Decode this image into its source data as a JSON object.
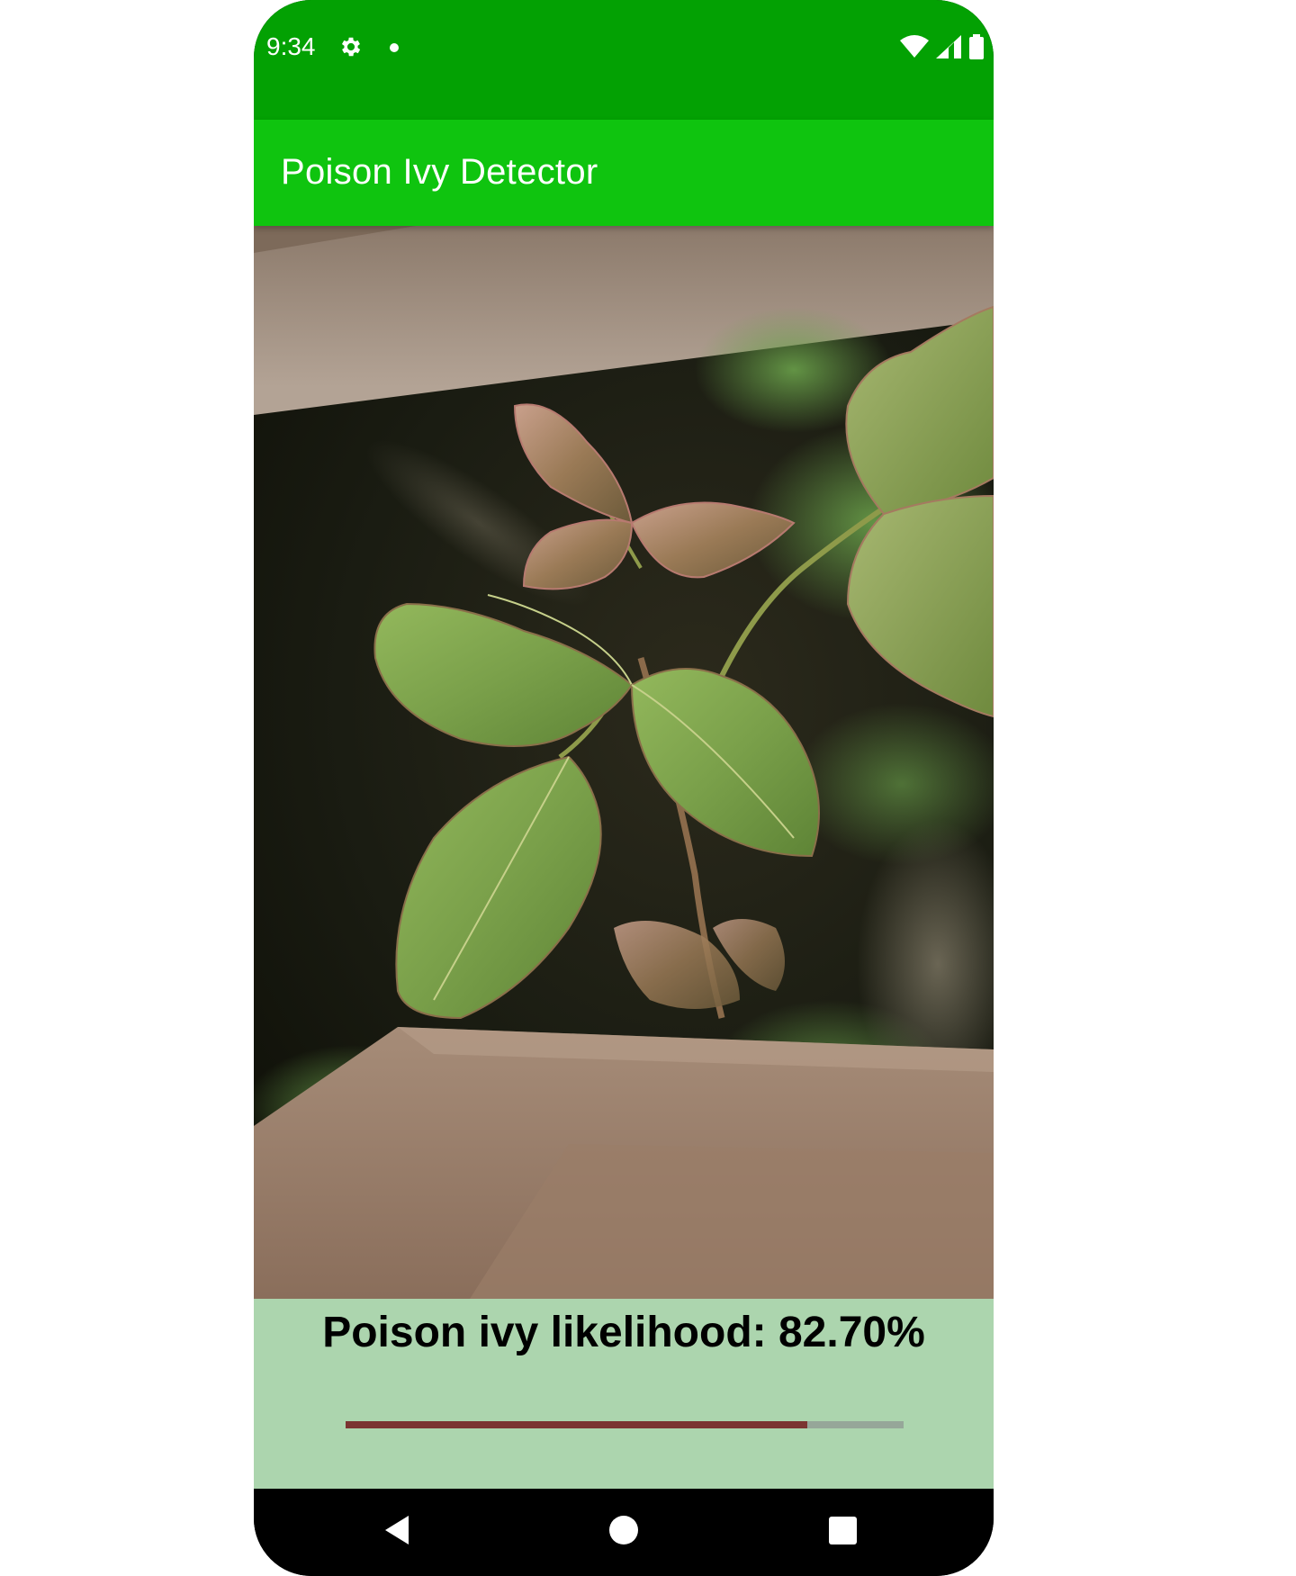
{
  "status_bar": {
    "time": "9:34",
    "icons": [
      "settings-gear-icon",
      "notification-dot-icon",
      "wifi-icon",
      "signal-icon",
      "battery-icon"
    ],
    "background_color": "#03a103"
  },
  "app_bar": {
    "title": "Poison Ivy Detector",
    "background_color": "#0fc40f"
  },
  "photo": {
    "subject": "poison ivy leaves"
  },
  "result": {
    "likelihood_text": "Poison ivy likelihood: 82.70%",
    "likelihood_percent": 82.7,
    "panel_color": "#acd5ae",
    "progress_color": "#7b3431",
    "track_color": "#96a799"
  },
  "nav_bar": {
    "buttons": [
      "back-icon",
      "home-icon",
      "recents-icon"
    ]
  }
}
